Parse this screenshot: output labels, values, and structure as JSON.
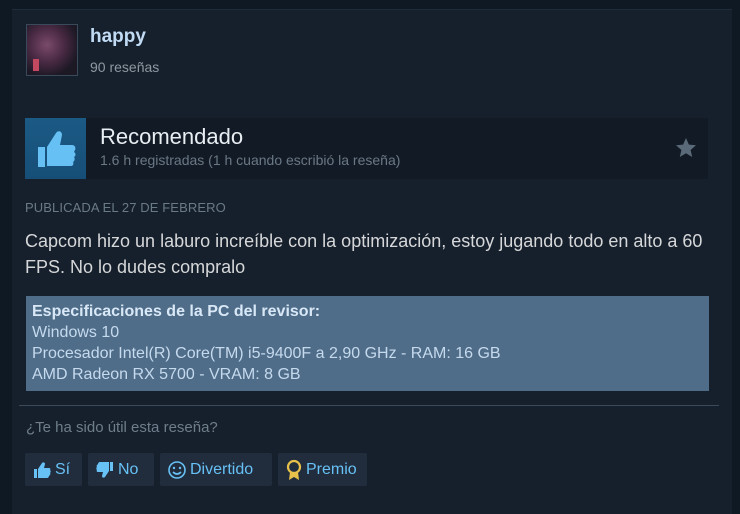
{
  "user": {
    "name": "happy",
    "reviews": "90 reseñas"
  },
  "verdict": {
    "title": "Recomendado",
    "hours": "1.6 h registradas (1 h cuando escribió la reseña)",
    "icon": "thumbs-up-icon"
  },
  "posted": "PUBLICADA EL 27 DE FEBRERO",
  "review": {
    "text": "Capcom hizo un laburo increíble con la optimización, estoy jugando todo en alto a 60 FPS. No lo dudes compralo"
  },
  "specs": {
    "title": "Especificaciones de la PC del revisor:",
    "lines": [
      "Windows 10",
      "Procesador Intel(R) Core(TM) i5-9400F a 2,90 GHz - RAM: 16 GB",
      "AMD Radeon RX 5700 - VRAM: 8 GB"
    ]
  },
  "helpful": {
    "question": "¿Te ha sido útil esta reseña?",
    "buttons": {
      "yes": "Sí",
      "no": "No",
      "funny": "Divertido",
      "award": "Premio"
    }
  },
  "colors": {
    "background": "#16202d",
    "link": "#67c1f5",
    "thumb_box": "#1b5a85",
    "specs_box": "#4f6d89"
  }
}
